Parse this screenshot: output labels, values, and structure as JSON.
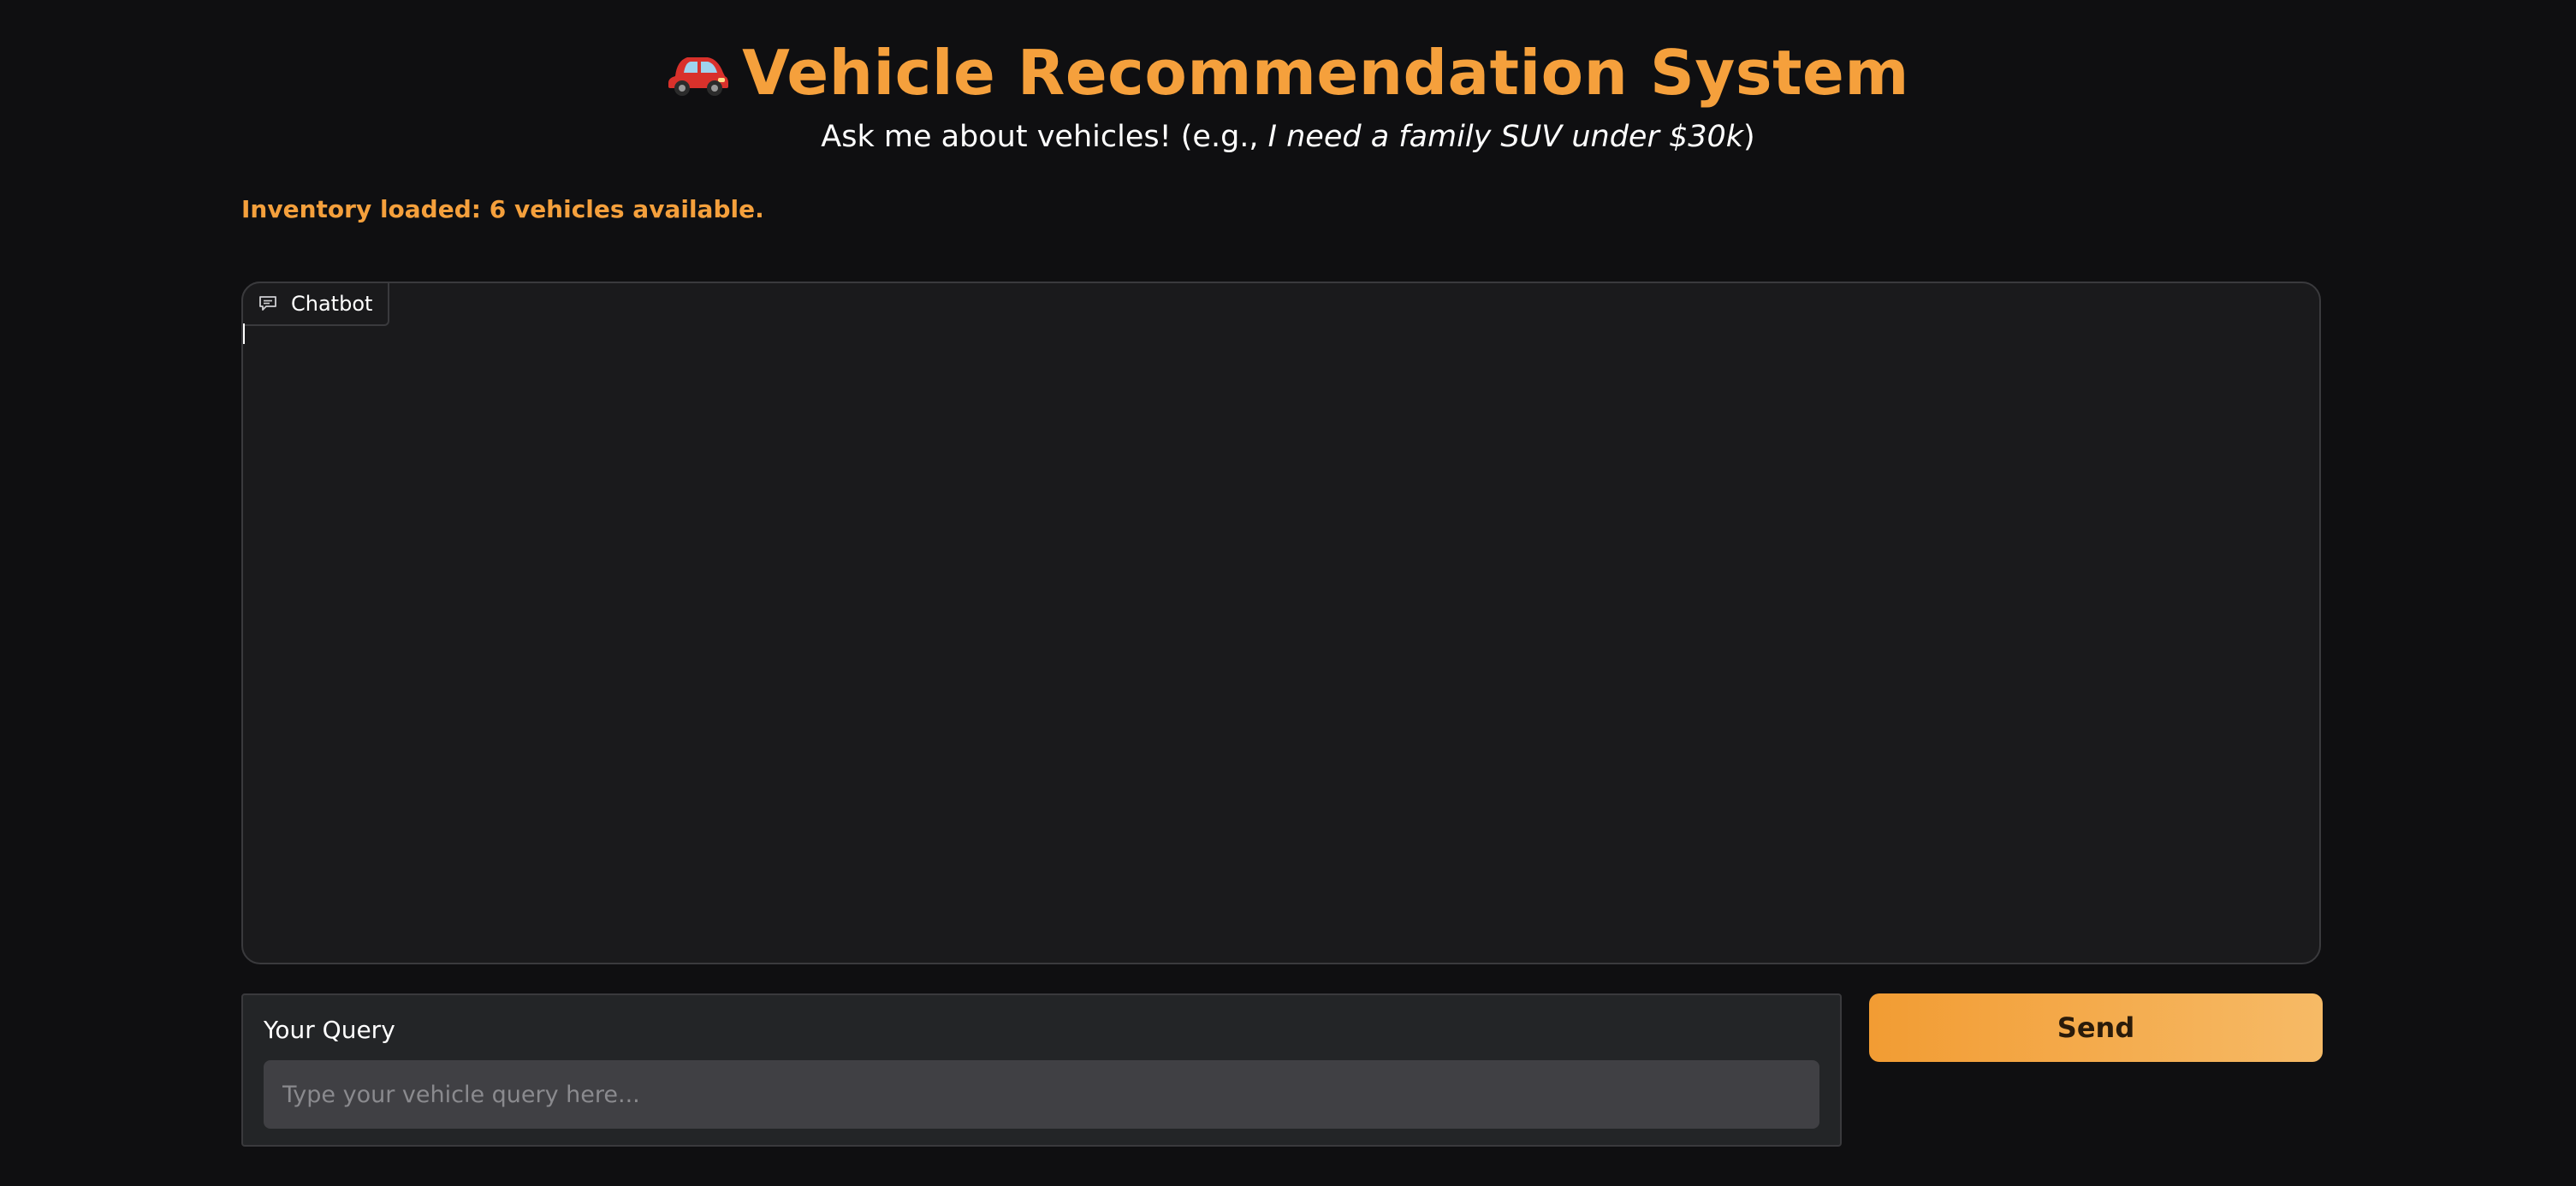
{
  "header": {
    "icon": "car-icon",
    "title": "Vehicle Recommendation System",
    "subtitle_prefix": "Ask me about vehicles! (e.g., ",
    "subtitle_example": "I need a family SUV under $30k",
    "subtitle_suffix": ")"
  },
  "status": {
    "inventory_text": "Inventory loaded: 6 vehicles available."
  },
  "chatbot": {
    "tab_icon": "chat-bubble-icon",
    "tab_label": "Chatbot"
  },
  "query": {
    "label": "Your Query",
    "value": "",
    "placeholder": "Type your vehicle query here..."
  },
  "send_button": {
    "label": "Send"
  },
  "colors": {
    "background": "#0f0f11",
    "accent": "#f5a03c",
    "panel": "#1a1a1c",
    "input_bg": "#404044"
  }
}
